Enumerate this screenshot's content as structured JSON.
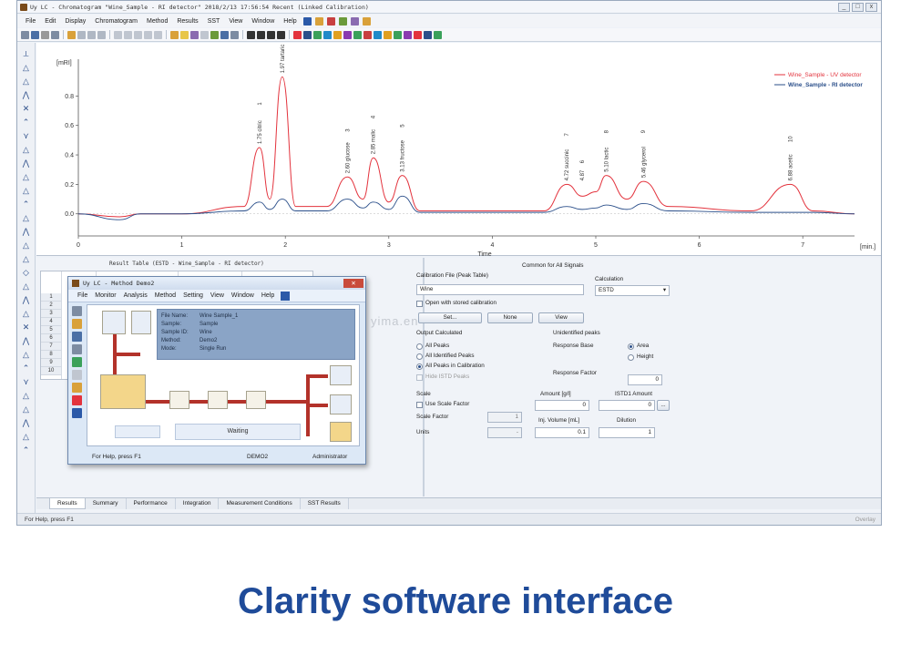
{
  "window": {
    "title": "Uy LC - Chromatogram \"Wine_Sample - RI detector\" 2018/2/13 17:56:54 Recent (Linked Calibration)",
    "controls": [
      "_",
      "□",
      "x"
    ]
  },
  "menu": [
    "File",
    "Edit",
    "Display",
    "Chromatogram",
    "Method",
    "Results",
    "SST",
    "View",
    "Window",
    "Help"
  ],
  "chart": {
    "y_unit": "[mRI]",
    "x_unit": "[min.]",
    "x_label": "Time",
    "legend": [
      {
        "label": "Wine_Sample - UV detector",
        "color": "#e3333d"
      },
      {
        "label": "Wine_Sample - RI detector",
        "color": "#2b4f8a"
      }
    ],
    "x_ticks": [
      "0",
      "1",
      "2",
      "3",
      "4",
      "5",
      "6",
      "7"
    ],
    "y_ticks": [
      "0.0",
      "0.2",
      "0.4",
      "0.6",
      "0.8"
    ],
    "peak_labels": [
      "1.75 citric",
      "1.97 tartaric",
      "2.60 glucose",
      "2.85 malic",
      "3.13 fructose",
      "4.87",
      "4.72 succinic",
      "5.10 lactic",
      "5.46 glycerol",
      "6.88 acetic"
    ],
    "peak_numbers": [
      "1",
      "2",
      "3",
      "4",
      "5",
      "6",
      "7",
      "8",
      "9",
      "10"
    ]
  },
  "chart_data": {
    "type": "line",
    "xlabel": "Time",
    "ylabel": "[mRI]",
    "xlim": [
      0,
      7.5
    ],
    "ylim": [
      -0.15,
      1.0
    ],
    "series": [
      {
        "name": "Wine_Sample - UV detector",
        "color": "#e3333d",
        "x": [
          0,
          0.4,
          0.6,
          1.0,
          1.6,
          1.75,
          1.85,
          1.97,
          2.1,
          2.4,
          2.6,
          2.75,
          2.85,
          3.0,
          3.13,
          3.3,
          4.5,
          4.72,
          4.87,
          5.0,
          5.1,
          5.3,
          5.46,
          5.7,
          6.5,
          6.88,
          7.1,
          7.5
        ],
        "y": [
          0,
          -0.02,
          0,
          0,
          0.05,
          0.45,
          0.1,
          0.93,
          0.05,
          0.05,
          0.25,
          0.1,
          0.38,
          0.08,
          0.26,
          0.02,
          0.02,
          0.2,
          0.12,
          0.15,
          0.26,
          0.1,
          0.22,
          0.05,
          0.02,
          0.2,
          0.02,
          0
        ]
      },
      {
        "name": "Wine_Sample - RI detector",
        "color": "#2b4f8a",
        "x": [
          0,
          0.4,
          0.6,
          1.0,
          1.6,
          1.75,
          1.85,
          1.97,
          2.1,
          2.4,
          2.6,
          2.75,
          2.85,
          3.0,
          3.13,
          3.3,
          4.5,
          4.72,
          4.87,
          5.0,
          5.1,
          5.3,
          5.46,
          5.7,
          6.5,
          6.88,
          7.1,
          7.5
        ],
        "y": [
          0,
          -0.04,
          0,
          0,
          0.02,
          0.08,
          0.03,
          0.1,
          0.02,
          0.02,
          0.1,
          0.04,
          0.08,
          0.03,
          0.12,
          0.01,
          0.01,
          0.05,
          0.03,
          0.04,
          0.06,
          0.03,
          0.07,
          0.02,
          0.01,
          0.01,
          0.01,
          0
        ]
      }
    ]
  },
  "result_table": {
    "title": "Result Table (ESTD - Wine_Sample - RI detector)",
    "row_numbers": [
      "1",
      "2",
      "3",
      "4",
      "5",
      "6",
      "7",
      "8",
      "9",
      "10"
    ]
  },
  "method_window": {
    "title": "Uy LC - Method  Demo2",
    "menu": [
      "File",
      "Monitor",
      "Analysis",
      "Method",
      "Setting",
      "View",
      "Window",
      "Help"
    ],
    "info": [
      {
        "key": "File Name:",
        "value": "Wine Sample_1"
      },
      {
        "key": "Sample:",
        "value": "Sample"
      },
      {
        "key": "Sample ID:",
        "value": "Wine"
      },
      {
        "key": "Method:",
        "value": "Demo2"
      },
      {
        "key": "Mode:",
        "value": "Single Run"
      }
    ],
    "waiting": "Waiting",
    "status_help": "For Help, press F1",
    "status_project": "DEMO2",
    "status_user": "Administrator"
  },
  "common": {
    "header": "Common for All Signals",
    "calibration_file_label": "Calibration File (Peak Table)",
    "calibration_file_value": "Wine",
    "calculation_label": "Calculation",
    "calculation_value": "ESTD",
    "open_stored_label": "Open with stored calibration",
    "btn_set": "Set...",
    "btn_none": "None",
    "btn_view": "View",
    "output_label": "Output Calculated",
    "opt_all_peaks": "All Peaks",
    "opt_identified": "All Identified Peaks",
    "opt_in_calibration": "All Peaks in Calibration",
    "opt_hide_istd": "Hide ISTD Peaks",
    "unidentified_label": "Unidentified peaks",
    "response_base_label": "Response Base",
    "opt_area": "Area",
    "opt_height": "Height",
    "response_factor_label": "Response Factor",
    "response_factor_value": "0",
    "scale_label": "Scale",
    "use_scale_factor": "Use Scale Factor",
    "scale_factor_label": "Scale Factor",
    "scale_factor_value": "1",
    "units_label": "Units",
    "units_value": "-",
    "amount_label": "Amount [g/l]",
    "amount_value": "0",
    "istd_label": "ISTD1 Amount",
    "istd_value": "0",
    "inj_volume_label": "Inj. Volume [mL]",
    "inj_volume_value": "0.1",
    "dilution_label": "Dilution",
    "dilution_value": "1",
    "ellipsis": "..."
  },
  "tabs": [
    "Results",
    "Summary",
    "Performance",
    "Integration",
    "Measurement Conditions",
    "SST Results"
  ],
  "statusbar": {
    "left": "For Help, press F1",
    "right": "Overlay"
  },
  "watermark": "yima.en",
  "caption": "Clarity software interface"
}
